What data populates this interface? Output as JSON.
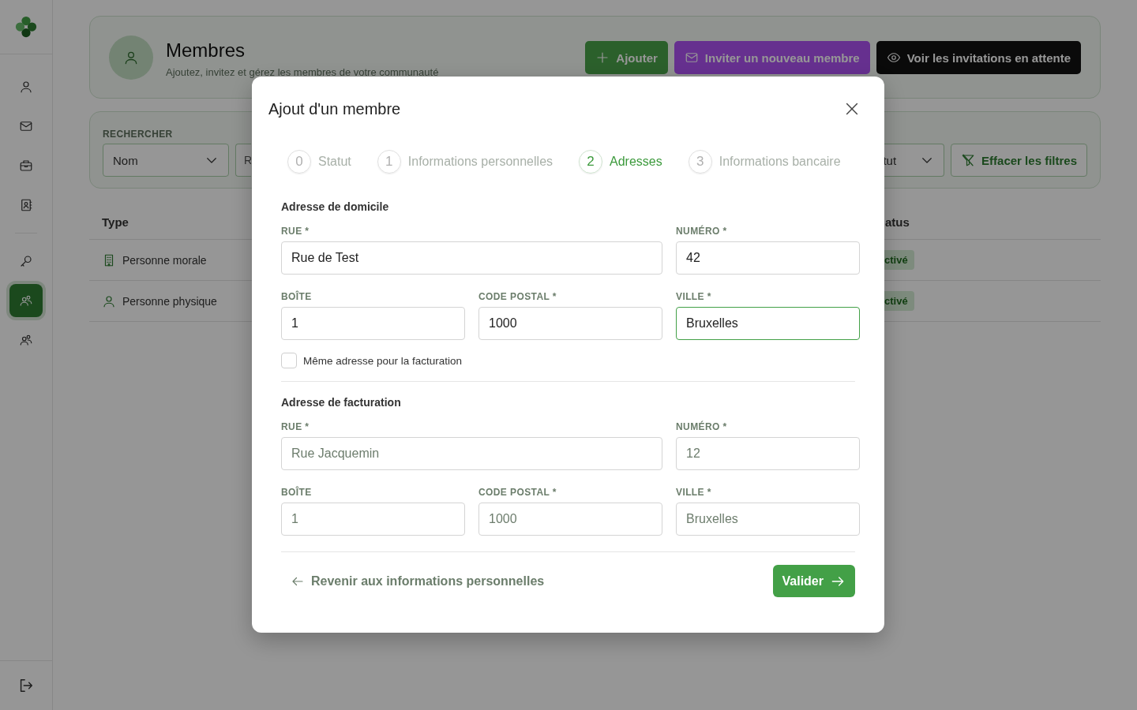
{
  "sidebar": {
    "items": [
      {
        "selected": false
      },
      {
        "selected": false
      },
      {
        "selected": false
      },
      {
        "selected": false
      },
      {
        "selected": false
      },
      {
        "selected": true
      },
      {
        "selected": false
      }
    ]
  },
  "header": {
    "title": "Membres",
    "subtitle": "Ajoutez, invitez et gérez les membres de votre communauté",
    "buttons": [
      {
        "label": "Ajouter",
        "kind": "add"
      },
      {
        "label": "Inviter un nouveau membre",
        "kind": "invite"
      },
      {
        "label": "Voir les invitations en attente",
        "kind": "pending"
      }
    ]
  },
  "filters": {
    "label": "RECHERCHER",
    "field_select": "Nom",
    "search_placeholder": "R",
    "status_select": "tut",
    "clear_button": "Effacer les filtres"
  },
  "table": {
    "columns": [
      "Type",
      "atus"
    ],
    "rows": [
      {
        "kind": "legal",
        "type": "Personne morale",
        "status": "ctivé"
      },
      {
        "kind": "natural",
        "type": "Personne physique",
        "status": "ctivé"
      }
    ]
  },
  "modal": {
    "title": "Ajout d'un membre",
    "steps": [
      {
        "number": "0",
        "label": "Statut",
        "selected": false
      },
      {
        "number": "1",
        "label": "Informations personnelles",
        "selected": false
      },
      {
        "number": "2",
        "label": "Adresses",
        "selected": true
      },
      {
        "number": "3",
        "label": "Informations bancaire",
        "selected": false
      }
    ],
    "sections": [
      {
        "title": "Adresse de domicile",
        "fields": [
          {
            "kind": "street",
            "label": "RUE *",
            "value": "Rue de Test",
            "focused": false
          },
          {
            "kind": "plain",
            "label": "NUMÉRO *",
            "value": "42",
            "focused": false
          },
          {
            "kind": "plain",
            "label": "BOÎTE",
            "value": "1",
            "focused": false
          },
          {
            "kind": "plain",
            "label": "CODE POSTAL *",
            "value": "1000",
            "focused": false
          },
          {
            "kind": "plain",
            "label": "VILLE *",
            "value": "Bruxelles",
            "focused": true
          }
        ],
        "checkbox": {
          "label": "Même adresse pour la facturation",
          "checked": false
        }
      },
      {
        "title": "Adresse de facturation",
        "fields": [
          {
            "kind": "street",
            "label": "RUE *",
            "placeholder": "Rue Jacquemin",
            "focused": false
          },
          {
            "kind": "plain",
            "label": "NUMÉRO *",
            "placeholder": "12",
            "focused": false
          },
          {
            "kind": "plain",
            "label": "BOÎTE",
            "placeholder": "1",
            "focused": false
          },
          {
            "kind": "plain",
            "label": "CODE POSTAL *",
            "placeholder": "1000",
            "focused": false
          },
          {
            "kind": "plain",
            "label": "VILLE *",
            "placeholder": "Bruxelles",
            "focused": false
          }
        ]
      }
    ],
    "back_link": "Revenir aux informations personnelles",
    "submit_button": "Valider"
  }
}
